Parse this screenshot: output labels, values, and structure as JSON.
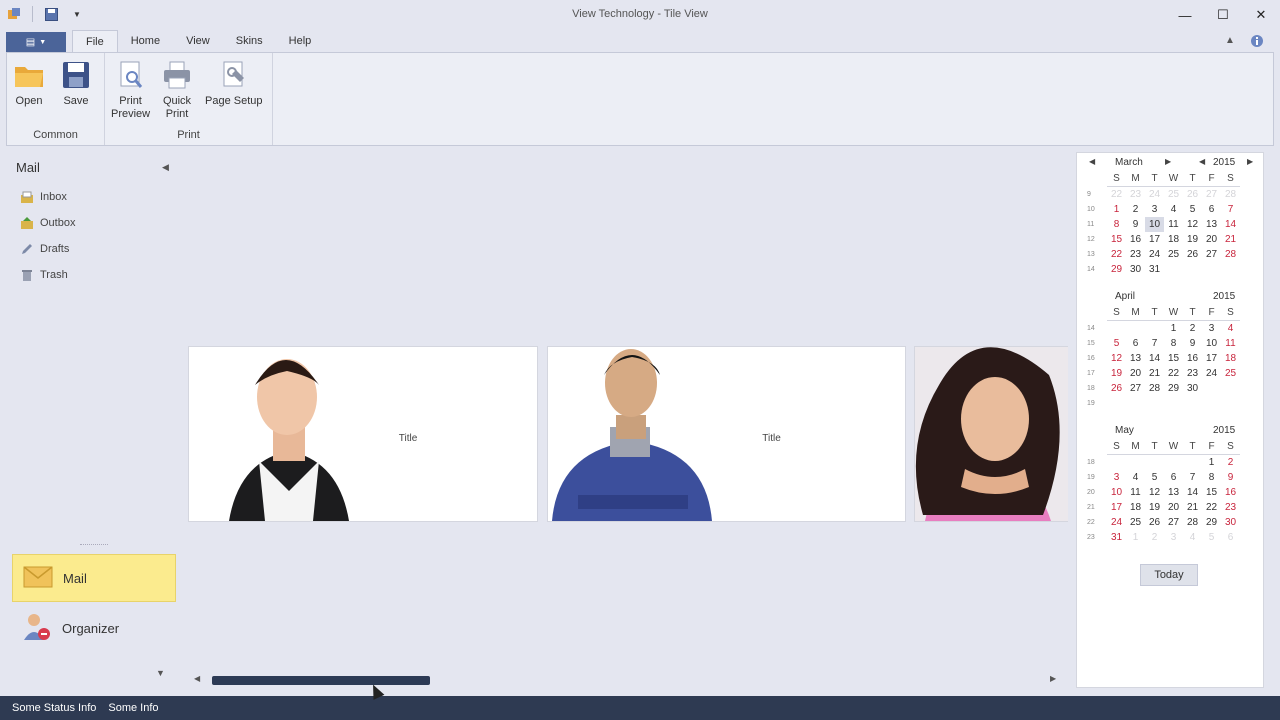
{
  "window": {
    "title": "View Technology - Tile View"
  },
  "ribbon": {
    "tabs": [
      {
        "label": "File",
        "active": true
      },
      {
        "label": "Home",
        "active": false
      },
      {
        "label": "View",
        "active": false
      },
      {
        "label": "Skins",
        "active": false
      },
      {
        "label": "Help",
        "active": false
      }
    ],
    "groups": {
      "common": {
        "caption": "Common",
        "open": "Open",
        "save": "Save"
      },
      "print": {
        "caption": "Print",
        "print_preview_l1": "Print",
        "print_preview_l2": "Preview",
        "quick_print_l1": "Quick",
        "quick_print_l2": "Print",
        "page_setup": "Page Setup"
      }
    }
  },
  "nav": {
    "header": "Mail",
    "items": [
      {
        "label": "Inbox",
        "icon": "inbox-icon"
      },
      {
        "label": "Outbox",
        "icon": "outbox-icon"
      },
      {
        "label": "Drafts",
        "icon": "pencil-icon"
      },
      {
        "label": "Trash",
        "icon": "trash-icon"
      }
    ],
    "groups": [
      {
        "label": "Mail",
        "icon": "envelope-icon",
        "active": true
      },
      {
        "label": "Organizer",
        "icon": "organizer-icon",
        "active": false
      }
    ]
  },
  "tiles": [
    {
      "title": "Title"
    },
    {
      "title": "Title"
    },
    {
      "title": ""
    }
  ],
  "calendar": {
    "day_headers": [
      "S",
      "M",
      "T",
      "W",
      "T",
      "F",
      "S"
    ],
    "today_label": "Today",
    "months": [
      {
        "name": "March",
        "year": "2015",
        "weeks": [
          {
            "wk": "9",
            "days": [
              "22",
              "23",
              "24",
              "25",
              "26",
              "27",
              "28"
            ]
          },
          {
            "wk": "10",
            "days": [
              "1",
              "2",
              "3",
              "4",
              "5",
              "6",
              "7"
            ]
          },
          {
            "wk": "11",
            "days": [
              "8",
              "9",
              "10",
              "11",
              "12",
              "13",
              "14"
            ]
          },
          {
            "wk": "12",
            "days": [
              "15",
              "16",
              "17",
              "18",
              "19",
              "20",
              "21"
            ]
          },
          {
            "wk": "13",
            "days": [
              "22",
              "23",
              "24",
              "25",
              "26",
              "27",
              "28"
            ]
          },
          {
            "wk": "14",
            "days": [
              "29",
              "30",
              "31",
              "",
              "",
              "",
              ""
            ]
          }
        ]
      },
      {
        "name": "April",
        "year": "2015",
        "weeks": [
          {
            "wk": "14",
            "days": [
              "",
              "",
              "",
              "1",
              "2",
              "3",
              "4"
            ]
          },
          {
            "wk": "15",
            "days": [
              "5",
              "6",
              "7",
              "8",
              "9",
              "10",
              "11"
            ]
          },
          {
            "wk": "16",
            "days": [
              "12",
              "13",
              "14",
              "15",
              "16",
              "17",
              "18"
            ]
          },
          {
            "wk": "17",
            "days": [
              "19",
              "20",
              "21",
              "22",
              "23",
              "24",
              "25"
            ]
          },
          {
            "wk": "18",
            "days": [
              "26",
              "27",
              "28",
              "29",
              "30",
              "",
              ""
            ]
          },
          {
            "wk": "19",
            "days": [
              "",
              "",
              "",
              "",
              "",
              "",
              ""
            ]
          }
        ]
      },
      {
        "name": "May",
        "year": "2015",
        "weeks": [
          {
            "wk": "18",
            "days": [
              "",
              "",
              "",
              "",
              "",
              "1",
              "2"
            ]
          },
          {
            "wk": "19",
            "days": [
              "3",
              "4",
              "5",
              "6",
              "7",
              "8",
              "9"
            ]
          },
          {
            "wk": "20",
            "days": [
              "10",
              "11",
              "12",
              "13",
              "14",
              "15",
              "16"
            ]
          },
          {
            "wk": "21",
            "days": [
              "17",
              "18",
              "19",
              "20",
              "21",
              "22",
              "23"
            ]
          },
          {
            "wk": "22",
            "days": [
              "24",
              "25",
              "26",
              "27",
              "28",
              "29",
              "30"
            ]
          },
          {
            "wk": "23",
            "days": [
              "31",
              "1",
              "2",
              "3",
              "4",
              "5",
              "6"
            ]
          }
        ]
      }
    ],
    "selected": {
      "month": "March",
      "day": "10"
    }
  },
  "status": {
    "left": "Some Status Info",
    "right": "Some Info"
  },
  "colors": {
    "accent": "#4b6499",
    "statusbar": "#2e3a52",
    "weekend": "#c8243c",
    "nav_active": "#fbeb8e"
  }
}
